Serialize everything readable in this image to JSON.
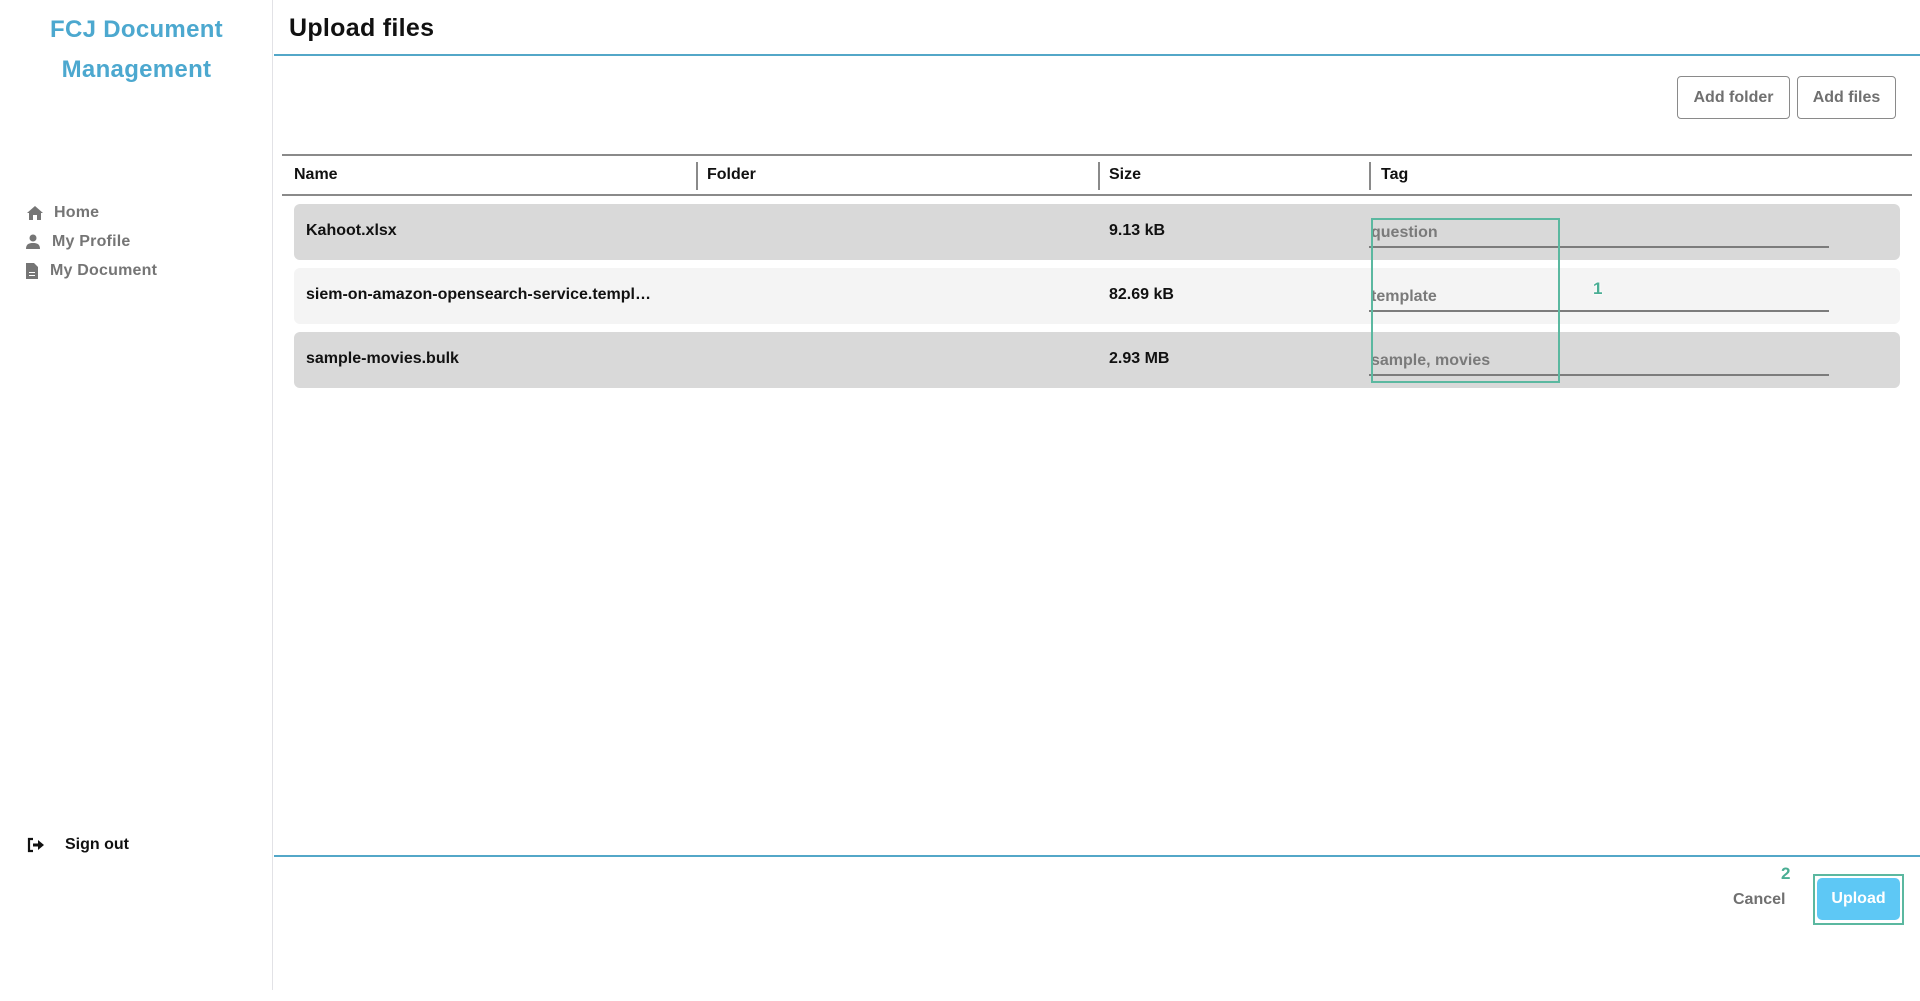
{
  "sidebar": {
    "brand": "FCJ Document Management",
    "brand_color": "#4ca8cf",
    "nav": [
      {
        "label": "Home",
        "icon": "home-icon"
      },
      {
        "label": "My Profile",
        "icon": "user-icon"
      },
      {
        "label": "My Document",
        "icon": "document-icon"
      }
    ],
    "signout": {
      "label": "Sign out",
      "icon": "sign-out-icon"
    }
  },
  "main": {
    "title": "Upload files",
    "toolbar": {
      "add_folder_label": "Add folder",
      "add_files_label": "Add files"
    },
    "table": {
      "columns": [
        "Name",
        "Folder",
        "Size",
        "Tag"
      ],
      "rows": [
        {
          "name": "Kahoot.xlsx",
          "folder": "",
          "size": "9.13 kB",
          "tag": "question"
        },
        {
          "name": "siem-on-amazon-opensearch-service.templ…",
          "folder": "",
          "size": "82.69 kB",
          "tag": "template"
        },
        {
          "name": "sample-movies.bulk",
          "folder": "",
          "size": "2.93 MB",
          "tag": "sample, movies"
        }
      ]
    },
    "footer": {
      "cancel_label": "Cancel",
      "upload_label": "Upload",
      "upload_color": "#5ec8f5"
    }
  },
  "annotations": [
    {
      "label": "1",
      "target": "tag-column-inputs"
    },
    {
      "label": "2",
      "target": "upload-button"
    }
  ],
  "accent_color": "#53a7c8"
}
